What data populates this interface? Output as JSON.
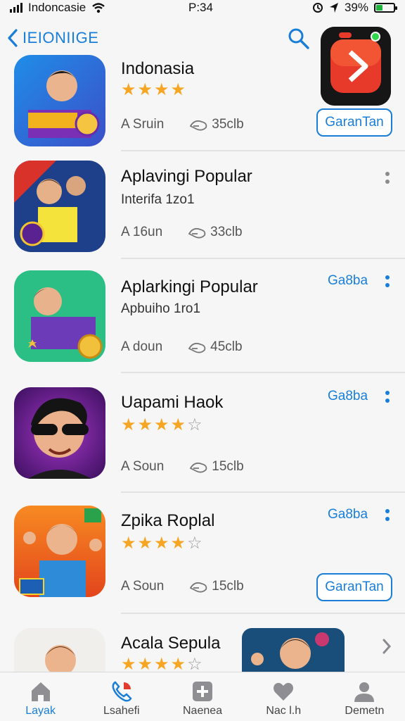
{
  "status_bar": {
    "carrier": "Indoncasie",
    "time": "P:34",
    "battery": "39%",
    "battery_level": 0.39
  },
  "header": {
    "back_label": "IEIONIIGE"
  },
  "apps": [
    {
      "title": "Indonasia",
      "subtitle": "",
      "rating": 4,
      "meta_left": "A Sruin",
      "meta_size": "35clb",
      "action": "GaranTan",
      "more": false
    },
    {
      "title": "Aplavingi Popular",
      "subtitle": "Interifa 1zo1",
      "rating": 0,
      "meta_left": "A 16un",
      "meta_size": "33clb",
      "action": "",
      "more": true
    },
    {
      "title": "Aplarkingi Popular",
      "subtitle": "Apbuiho 1ro1",
      "rating": 0,
      "meta_left": "A doun",
      "meta_size": "45clb",
      "action_link": "Ga8ba",
      "more": true
    },
    {
      "title": "Uapami Haok",
      "subtitle": "",
      "rating": 4,
      "meta_left": "A Soun",
      "meta_size": "15clb",
      "action_link": "Ga8ba",
      "more": true
    },
    {
      "title": "Zpika Roplal",
      "subtitle": "",
      "rating": 4,
      "meta_left": "A Soun",
      "meta_size": "15clb",
      "action_link": "Ga8ba",
      "action": "GaranTan",
      "more": true
    },
    {
      "title": "Acala Sepula",
      "subtitle": "",
      "rating": 4,
      "meta_left": "",
      "meta_size": "",
      "more": false
    }
  ],
  "tabs": [
    {
      "label": "Layak",
      "icon": "home-icon",
      "active": true
    },
    {
      "label": "Lsahefi",
      "icon": "phone-icon",
      "active": false
    },
    {
      "label": "Naenea",
      "icon": "add-icon",
      "active": false
    },
    {
      "label": "Nac l.h",
      "icon": "heart-icon",
      "active": false
    },
    {
      "label": "Demetn",
      "icon": "person-icon",
      "active": false
    }
  ],
  "colors": {
    "accent": "#1a7ed8",
    "star": "#f6a623",
    "background": "#f6f6f7"
  }
}
